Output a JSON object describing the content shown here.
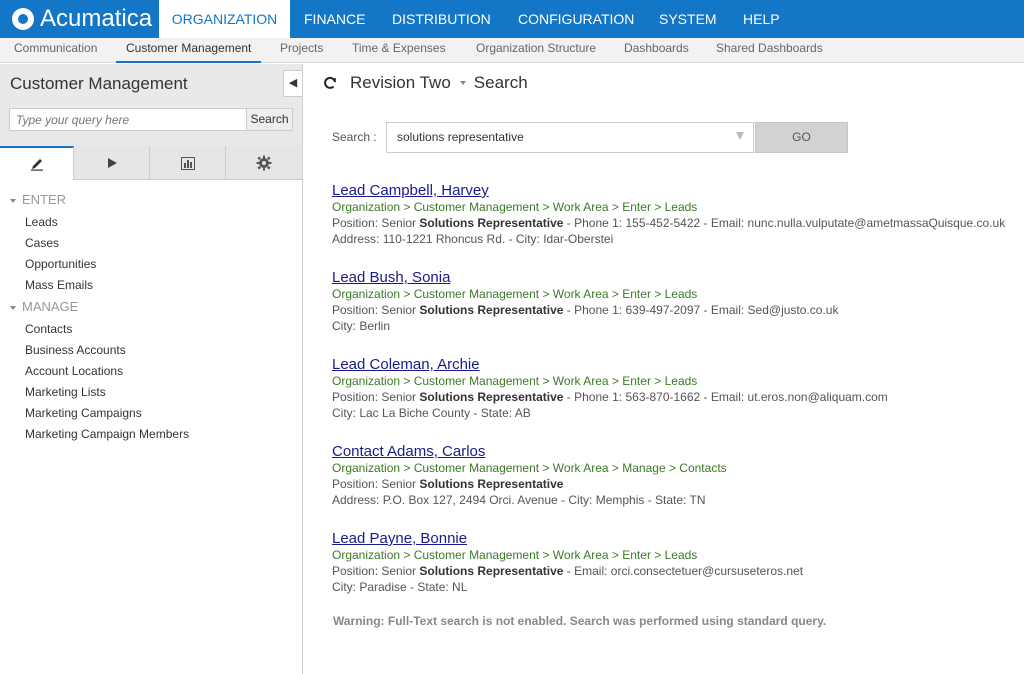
{
  "brand": {
    "name": "Acumatica"
  },
  "topnav": {
    "tabs": [
      {
        "label": "ORGANIZATION",
        "active": true
      },
      {
        "label": "FINANCE"
      },
      {
        "label": "DISTRIBUTION"
      },
      {
        "label": "CONFIGURATION"
      },
      {
        "label": "SYSTEM"
      },
      {
        "label": "HELP"
      }
    ]
  },
  "subnav": {
    "tabs": [
      {
        "label": "Communication"
      },
      {
        "label": "Customer Management",
        "active": true
      },
      {
        "label": "Projects"
      },
      {
        "label": "Time & Expenses"
      },
      {
        "label": "Organization Structure"
      },
      {
        "label": "Dashboards"
      },
      {
        "label": "Shared Dashboards"
      }
    ]
  },
  "sidebar": {
    "title": "Customer Management",
    "search_placeholder": "Type your query here",
    "search_button": "Search",
    "tabs": [
      "pencil-icon",
      "play-icon",
      "chart-icon",
      "gear-icon"
    ],
    "groups": [
      {
        "label": "ENTER",
        "items": [
          "Leads",
          "Cases",
          "Opportunities",
          "Mass Emails"
        ]
      },
      {
        "label": "MANAGE",
        "items": [
          "Contacts",
          "Business Accounts",
          "Account Locations",
          "Marketing Lists",
          "Marketing Campaigns",
          "Marketing Campaign Members"
        ]
      }
    ]
  },
  "main": {
    "breadcrumb": {
      "revision": "Revision Two",
      "page": "Search"
    },
    "search": {
      "label": "Search :",
      "value": "solutions representative",
      "go_label": "GO"
    },
    "results": [
      {
        "title": "Lead Campbell, Harvey",
        "path": "Organization > Customer Management > Work Area > Enter > Leads",
        "line1_pre": "Position: Senior ",
        "line1_bold": "Solutions Representative",
        "line1_post": " - Phone 1: 155-452-5422 - Email: nunc.nulla.vulputate@ametmassaQuisque.co.uk",
        "line2": "Address: 110-1221 Rhoncus Rd. - City: Idar-Oberstei"
      },
      {
        "title": "Lead Bush, Sonia",
        "path": "Organization > Customer Management > Work Area > Enter > Leads",
        "line1_pre": "Position: Senior ",
        "line1_bold": "Solutions Representative",
        "line1_post": " - Phone 1: 639-497-2097 - Email: Sed@justo.co.uk",
        "line2": "City: Berlin"
      },
      {
        "title": "Lead Coleman, Archie",
        "path": "Organization > Customer Management > Work Area > Enter > Leads",
        "line1_pre": "Position: Senior ",
        "line1_bold": "Solutions Representative",
        "line1_post": " - Phone 1: 563-870-1662 - Email: ut.eros.non@aliquam.com",
        "line2": "City: Lac La Biche County - State: AB"
      },
      {
        "title": "Contact Adams, Carlos",
        "path": "Organization > Customer Management > Work Area > Manage > Contacts",
        "line1_pre": "Position: Senior ",
        "line1_bold": "Solutions Representative",
        "line1_post": "",
        "line2": "Address: P.O. Box 127, 2494 Orci. Avenue - City: Memphis - State: TN"
      },
      {
        "title": "Lead Payne, Bonnie",
        "path": "Organization > Customer Management > Work Area > Enter > Leads",
        "line1_pre": "Position: Senior ",
        "line1_bold": "Solutions Representative",
        "line1_post": " - Email: orci.consectetuer@cursuseteros.net",
        "line2": "City: Paradise - State: NL"
      }
    ],
    "warning": "Warning: Full-Text search is not enabled. Search was performed using standard query."
  },
  "colors": {
    "brand": "#1376c6",
    "link": "#1a1a8e",
    "path": "#3a7a2a"
  }
}
